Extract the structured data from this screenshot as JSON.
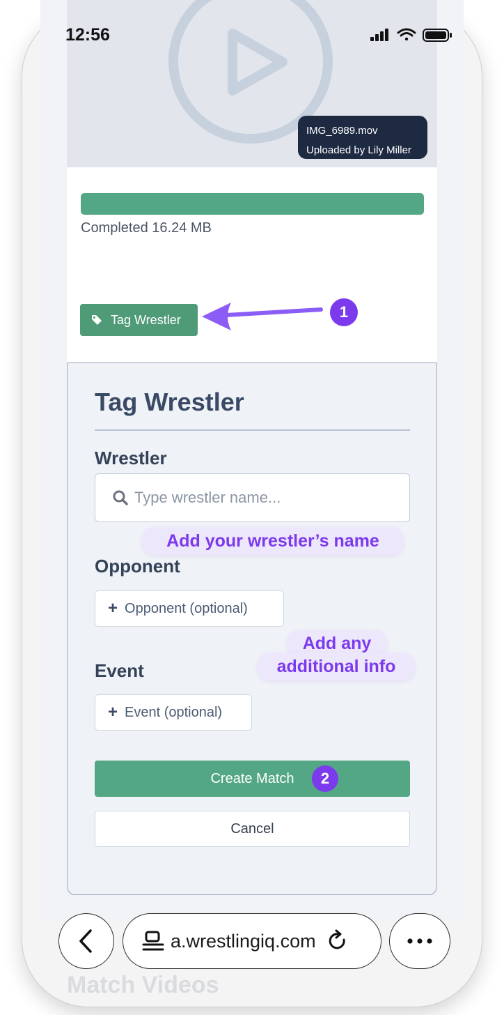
{
  "status_bar": {
    "time": "12:56"
  },
  "video": {
    "filename": "IMG_6989.mov",
    "uploaded_by": "Uploaded by Lily Miller"
  },
  "upload": {
    "status_text": "Completed 16.24 MB",
    "progress_percent": 100
  },
  "tag_button": {
    "label": "Tag Wrestler"
  },
  "steps": {
    "one": "1",
    "two": "2"
  },
  "form": {
    "title": "Tag Wrestler",
    "wrestler_label": "Wrestler",
    "wrestler_placeholder": "Type wrestler name...",
    "opponent_label": "Opponent",
    "opponent_button": "Opponent (optional)",
    "event_label": "Event",
    "event_button": "Event (optional)",
    "create_button": "Create Match",
    "cancel_button": "Cancel"
  },
  "hints": {
    "wrestler": "Add your wrestler’s name",
    "additional_line1": "Add any",
    "additional_line2": "additional info"
  },
  "background_heading": "Match Videos",
  "browser": {
    "url": "a.wrestlingiq.com"
  },
  "colors": {
    "accent_green": "#53a784",
    "hint_purple": "#7c3aed",
    "navy": "#1d2a42"
  }
}
